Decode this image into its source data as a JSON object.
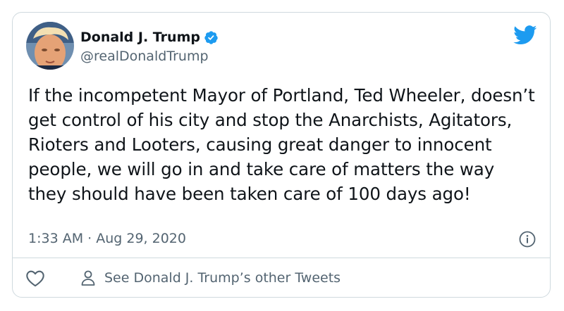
{
  "author": {
    "display_name": "Donald J. Trump",
    "handle": "@realDonaldTrump",
    "verified": true
  },
  "tweet": {
    "text": "If the incompetent Mayor of Portland, Ted Wheeler, doesn’t get control of his city and stop the Anarchists, Agitators, Rioters and Looters, causing great danger to innocent people, we will go in and take care of matters the way they should have been taken care of 100 days ago!",
    "timestamp": "1:33 AM · Aug 29, 2020"
  },
  "footer": {
    "other_tweets_label": "See Donald J. Trump’s other Tweets"
  },
  "icons": {
    "brand": "twitter-logo-icon",
    "verified": "verified-badge-icon",
    "info": "info-icon",
    "like": "heart-icon",
    "profile": "person-icon"
  },
  "colors": {
    "brand_blue": "#1d9bf0",
    "text_primary": "#0f1419",
    "text_secondary": "#536471",
    "border": "#cfd9de"
  }
}
